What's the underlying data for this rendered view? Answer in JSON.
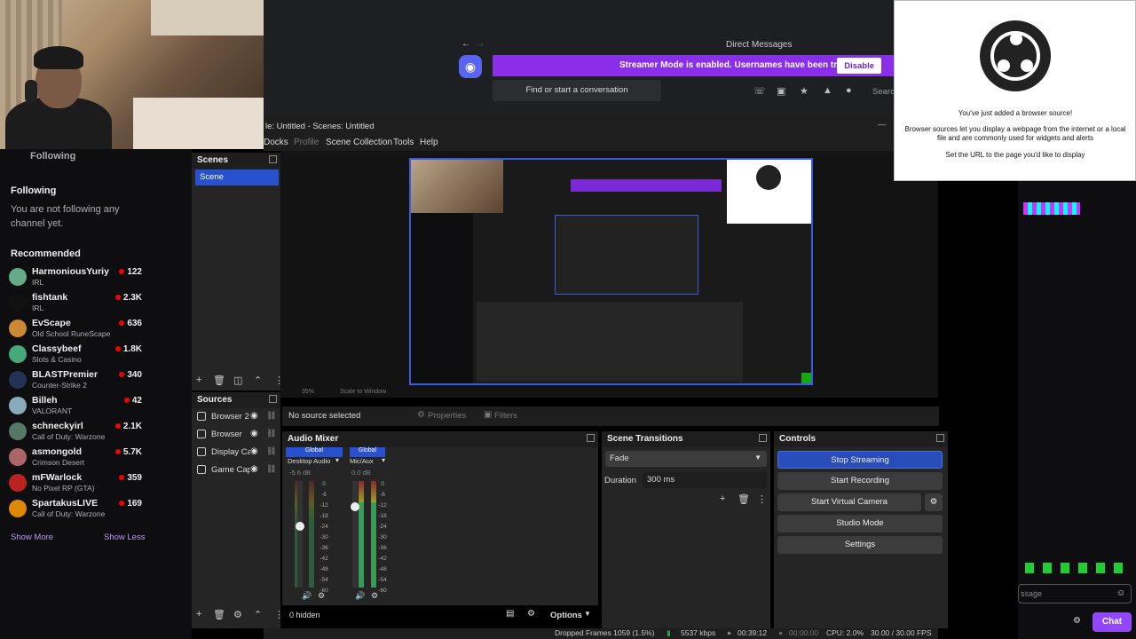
{
  "discord": {
    "title": "Direct Messages",
    "streamer_notice": "Streamer Mode is enabled. Usernames have been truncated.",
    "disable_label": "Disable",
    "find_label": "Find or start a conversation",
    "search_label": "Searc"
  },
  "twitch": {
    "following_top": "Following",
    "following_heading": "Following",
    "not_following_text": "You are not following any channel yet.",
    "recommended_heading": "Recommended",
    "channels": [
      {
        "name": "HarmoniousYuriy",
        "game": "IRL",
        "viewers": "122",
        "color": "#6a8"
      },
      {
        "name": "fishtank",
        "game": "IRL",
        "viewers": "2.3K",
        "color": "#111"
      },
      {
        "name": "EvScape",
        "game": "Old School RuneScape",
        "viewers": "636",
        "color": "#c83"
      },
      {
        "name": "Classybeef",
        "game": "Slots & Casino",
        "viewers": "1.8K",
        "color": "#4a7"
      },
      {
        "name": "BLASTPremier",
        "game": "Counter-Strike 2",
        "viewers": "340",
        "color": "#235"
      },
      {
        "name": "Billeh",
        "game": "VALORANT",
        "viewers": "42",
        "color": "#8ab"
      },
      {
        "name": "schneckyirl",
        "game": "Call of Duty: Warzone",
        "viewers": "2.1K",
        "color": "#576"
      },
      {
        "name": "asmongold",
        "game": "Crimson Desert",
        "viewers": "5.7K",
        "color": "#a66"
      },
      {
        "name": "mFWarlock",
        "game": "No Pixel RP (GTA)",
        "viewers": "359",
        "color": "#b22"
      },
      {
        "name": "SpartakusLIVE",
        "game": "Call of Duty: Warzone",
        "viewers": "169",
        "color": "#d80"
      }
    ],
    "show_more": "Show More",
    "show_less": "Show Less",
    "chat_label": "Chat",
    "chat_placeholder": "ssage"
  },
  "obs": {
    "window_title": "le: Untitled - Scenes: Untitled",
    "menu": [
      "Docks",
      "Profile",
      "Scene Collection",
      "Tools",
      "Help"
    ],
    "scenes_heading": "Scenes",
    "scene_item": "Scene",
    "sources_heading": "Sources",
    "sources": [
      "Browser 2",
      "Browser",
      "Display Ca",
      "Game Cap"
    ],
    "no_source": "No source selected",
    "properties_label": "Properties",
    "filters_label": "Filters",
    "audio_heading": "Audio Mixer",
    "global_label": "Global",
    "desktop_audio": "Desktop Audio",
    "desktop_db": "-5.6 dB",
    "mic_aux": "Mic/Aux",
    "mic_db": "0.0 dB",
    "meter_scale": [
      "0",
      "-6",
      "-12",
      "-18",
      "-24",
      "-30",
      "-36",
      "-42",
      "-48",
      "-54",
      "-60"
    ],
    "desktop_level": 0.62,
    "mic_level": 0.8,
    "transitions_heading": "Scene Transitions",
    "transition_value": "Fade",
    "duration_label": "Duration",
    "duration_value": "300 ms",
    "controls_heading": "Controls",
    "stop_streaming": "Stop Streaming",
    "start_recording": "Start Recording",
    "start_virtual_camera": "Start Virtual Camera",
    "studio_mode": "Studio Mode",
    "settings": "Settings",
    "hidden_count": "0 hidden",
    "options_label": "Options",
    "zoom_label": "35%",
    "scale_label": "Scale to Window",
    "status": {
      "dropped": "Dropped Frames 1059 (1.5%)",
      "bitrate": "5537 kbps",
      "live_time": "00:39:12",
      "rec_time": "00:00:00",
      "cpu": "CPU: 2.0%",
      "fps": "30.00 / 30.00 FPS"
    }
  },
  "popup": {
    "line1": "You've just added a browser source!",
    "line2": "Browser sources let you display a webpage from the internet or a local file and are commonly used for widgets and alerts",
    "line3": "Set the URL to the page you'd like to display"
  },
  "colors": {
    "accent": "#284cb8",
    "discord_purple": "#8b2eea",
    "twitch_purple": "#9147ff",
    "live_red": "#eb0400"
  }
}
